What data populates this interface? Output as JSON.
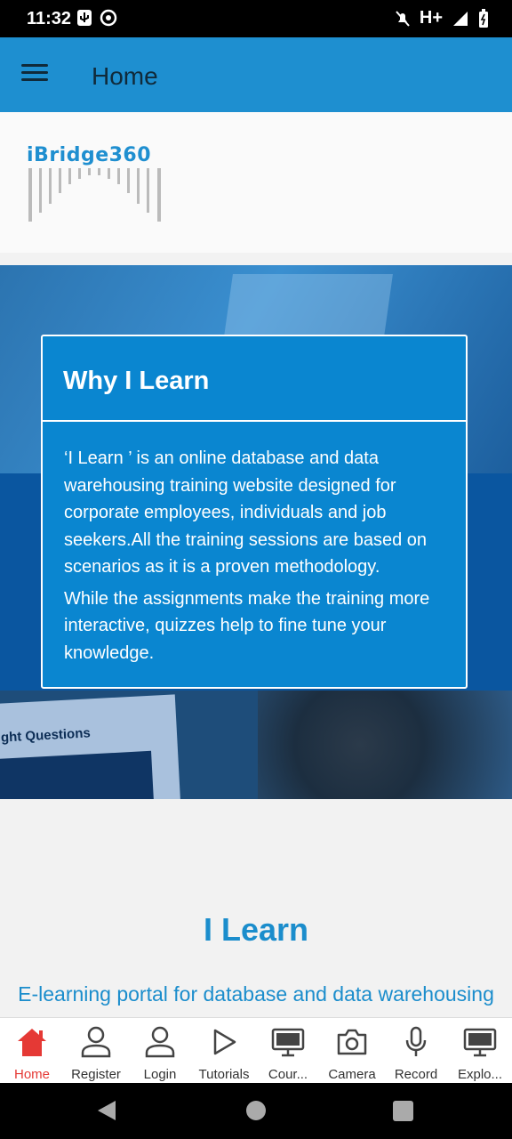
{
  "status": {
    "time": "11:32",
    "network": "H+"
  },
  "appbar": {
    "title": "Home"
  },
  "logo": {
    "text": "Bridge360",
    "prefix": "i"
  },
  "hero": {
    "paper_text": "ght Questions",
    "card_title": "Why I Learn",
    "card_p1": "‘I Learn ’ is an online database and data warehousing training website designed for corporate employees, individuals and job seekers.All the training sessions are based on scenarios as it is a proven methodology.",
    "card_p2": "While the assignments make the training more interactive, quizzes help to fine tune your knowledge."
  },
  "intro": {
    "title": "I Learn",
    "subtitle": "E-learning portal for database and data warehousing"
  },
  "bottom_nav": {
    "items": [
      {
        "label": "Home",
        "icon": "home-icon",
        "active": true
      },
      {
        "label": "Register",
        "icon": "person-icon"
      },
      {
        "label": "Login",
        "icon": "person-icon"
      },
      {
        "label": "Tutorials",
        "icon": "play-icon"
      },
      {
        "label": "Cour...",
        "icon": "monitor-icon"
      },
      {
        "label": "Camera",
        "icon": "camera-icon"
      },
      {
        "label": "Record",
        "icon": "microphone-icon"
      },
      {
        "label": "Explo...",
        "icon": "monitor-icon"
      }
    ]
  },
  "colors": {
    "primary": "#1e8fd0",
    "card": "#0a86d0",
    "accent_active": "#e53935",
    "heading": "#1b8dcc"
  }
}
